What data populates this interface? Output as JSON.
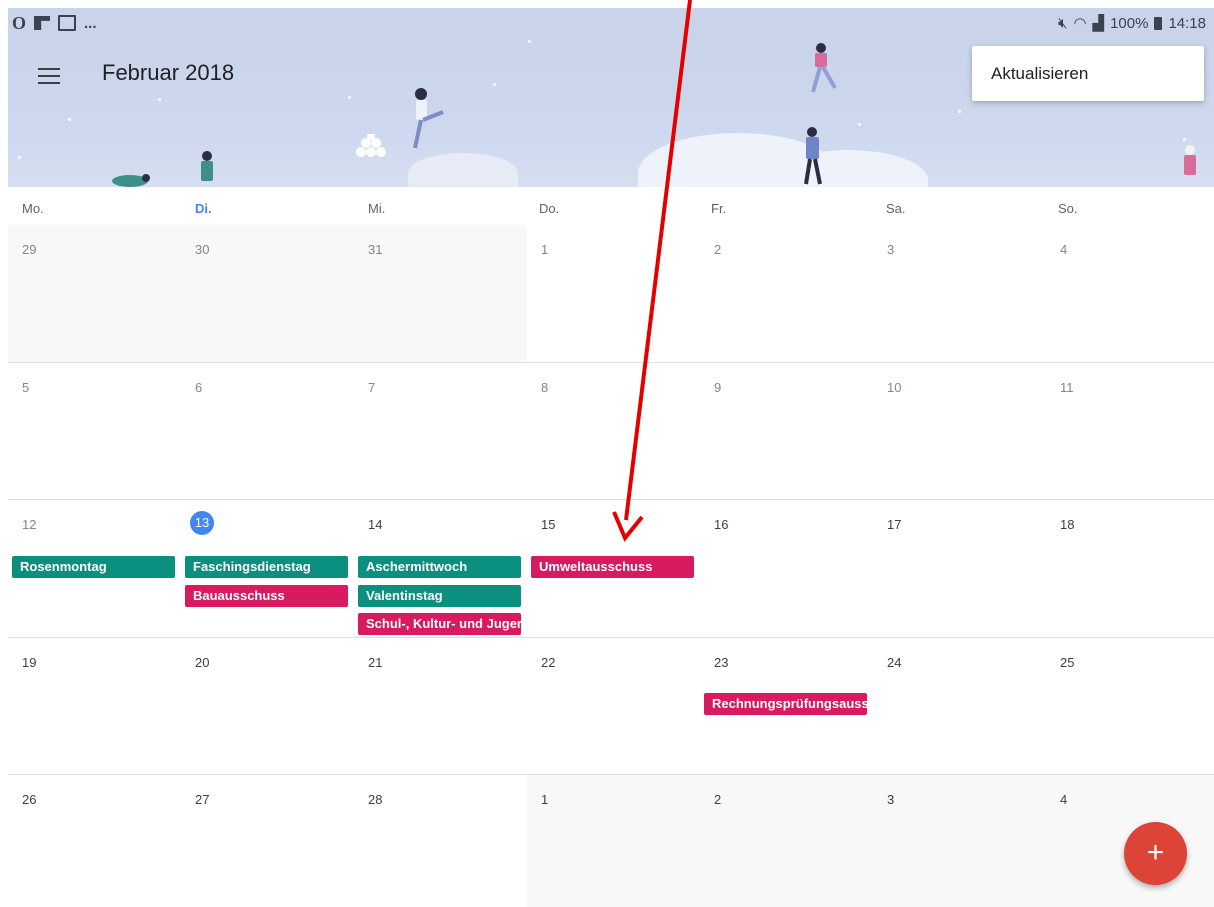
{
  "status_bar": {
    "left_icons": [
      "opera-icon",
      "flipboard-icon",
      "gallery-icon"
    ],
    "ellipsis": "...",
    "battery": "100%",
    "time": "14:18"
  },
  "header": {
    "title": "Februar 2018"
  },
  "menu": {
    "refresh_label": "Aktualisieren"
  },
  "weekdays": [
    "Mo.",
    "Di.",
    "Mi.",
    "Do.",
    "Fr.",
    "Sa.",
    "So."
  ],
  "weeks": [
    [
      "29",
      "30",
      "31",
      "1",
      "2",
      "3",
      "4"
    ],
    [
      "5",
      "6",
      "7",
      "8",
      "9",
      "10",
      "11"
    ],
    [
      "12",
      "13",
      "14",
      "15",
      "16",
      "17",
      "18"
    ],
    [
      "19",
      "20",
      "21",
      "22",
      "23",
      "24",
      "25"
    ],
    [
      "26",
      "27",
      "28",
      "1",
      "2",
      "3",
      "4"
    ]
  ],
  "events": {
    "rosenmontag": "Rosenmontag",
    "faschingsdienstag": "Faschingsdienstag",
    "bauausschuss": "Bauausschuss",
    "aschermittwoch": "Aschermittwoch",
    "valentinstag": "Valentinstag",
    "schulausschuss": "Schul-, Kultur- und Jugendausschuss",
    "umweltausschuss": "Umweltausschuss",
    "rechnungspruefung": "Rechnungsprüfungsausschuss"
  },
  "colors": {
    "teal": "#0b8f7e",
    "pink": "#d81b60",
    "accent": "#4285f4",
    "fab": "#db4437",
    "annotation_arrow": "#e50000"
  },
  "fab": {
    "label": "+"
  }
}
